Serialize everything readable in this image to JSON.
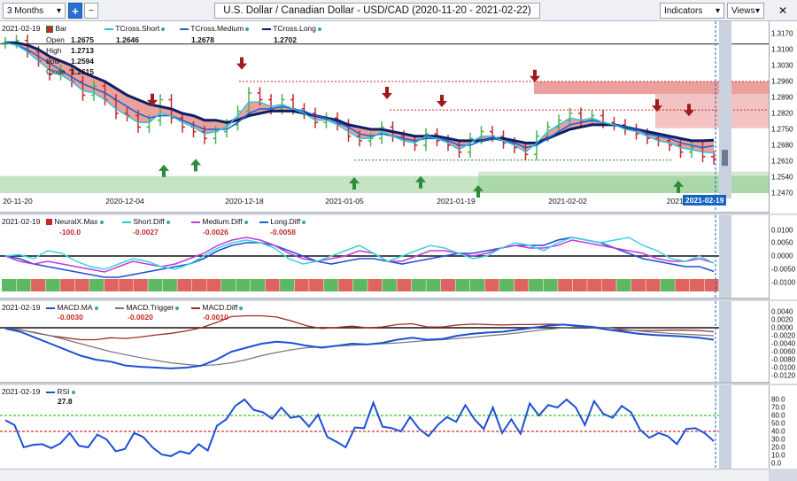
{
  "toolbar": {
    "period": "3 Months",
    "title": "U.S. Dollar / Canadian Dollar - USD/CAD (2020-11-20 - 2021-02-22)",
    "indicators": "Indicators",
    "views": "Views"
  },
  "price_pane": {
    "legend": {
      "date": "2021-02-19",
      "bar_label": "Bar",
      "open_label": "Open",
      "open": "1.2675",
      "high_label": "High",
      "high": "1.2713",
      "low_label": "Low",
      "low": "1.2594",
      "close_label": "Close",
      "close": "1.2615",
      "short_label": "TCross.Short",
      "short": "1.2646",
      "medium_label": "TCross.Medium",
      "medium": "1.2678",
      "long_label": "TCross.Long",
      "long": "1.2702"
    },
    "yticks": [
      "1.3170",
      "1.3100",
      "1.3030",
      "1.2960",
      "1.2890",
      "1.2820",
      "1.2750",
      "1.2680",
      "1.2610",
      "1.2540",
      "1.2470"
    ],
    "dates": [
      "20-11-20",
      "2020-12-04",
      "2020-12-18",
      "2021-01-05",
      "2021-01-19",
      "2021-02-02",
      "2021-0"
    ],
    "current_date": "2021-02-19"
  },
  "diff_pane": {
    "legend": {
      "date": "2021-02-19",
      "neural_label": "NeuralX.Max",
      "neural": "-100.0",
      "short_label": "Short.Diff",
      "short": "-0.0027",
      "medium_label": "Medium.Diff",
      "medium": "-0.0026",
      "long_label": "Long.Diff",
      "long": "-0.0058"
    },
    "yticks": [
      "0.0100",
      "0.0050",
      "0.0000",
      "-0.0050",
      "-0.0100"
    ]
  },
  "macd_pane": {
    "legend": {
      "date": "2021-02-19",
      "ma_label": "MACD.MA",
      "ma": "-0.0030",
      "trigger_label": "MACD.Trigger",
      "trigger": "-0.0020",
      "diff_label": "MACD.Diff",
      "diff": "-0.0010"
    },
    "yticks": [
      "0.0040",
      "0.0020",
      "0.0000",
      "-0.0020",
      "-0.0040",
      "-0.0060",
      "-0.0080",
      "-0.0100",
      "-0.0120"
    ]
  },
  "rsi_pane": {
    "legend": {
      "date": "2021-02-19",
      "rsi_label": "RSI",
      "rsi": "27.8"
    },
    "yticks": [
      "80.0",
      "70.0",
      "60.0",
      "50.0",
      "40.0",
      "30.0",
      "20.0",
      "10.0",
      "0.0"
    ]
  },
  "colors": {
    "bull": "#4caf50",
    "bear": "#c62828",
    "short": "#26c6da",
    "medium": "#1e63d6",
    "long": "#0b1f66",
    "cloud_red": "#d9534f",
    "cloud_green": "#7cc47a",
    "accent": "#1565c0"
  },
  "series": {
    "price_close": [
      1.313,
      1.314,
      1.309,
      1.305,
      1.299,
      1.301,
      1.296,
      1.29,
      1.294,
      1.288,
      1.282,
      1.281,
      1.276,
      1.279,
      1.288,
      1.28,
      1.276,
      1.274,
      1.271,
      1.274,
      1.277,
      1.283,
      1.291,
      1.288,
      1.284,
      1.288,
      1.284,
      1.282,
      1.278,
      1.28,
      1.277,
      1.272,
      1.27,
      1.271,
      1.276,
      1.272,
      1.27,
      1.268,
      1.273,
      1.27,
      1.268,
      1.265,
      1.271,
      1.274,
      1.272,
      1.269,
      1.267,
      1.264,
      1.272,
      1.276,
      1.279,
      1.282,
      1.279,
      1.281,
      1.278,
      1.277,
      1.275,
      1.273,
      1.271,
      1.27,
      1.268,
      1.265,
      1.267,
      1.263,
      1.262
    ],
    "tcross_short": [
      1.313,
      1.312,
      1.309,
      1.305,
      1.301,
      1.299,
      1.296,
      1.292,
      1.291,
      1.288,
      1.284,
      1.281,
      1.278,
      1.278,
      1.282,
      1.281,
      1.278,
      1.276,
      1.273,
      1.274,
      1.276,
      1.281,
      1.287,
      1.287,
      1.285,
      1.286,
      1.284,
      1.282,
      1.279,
      1.279,
      1.277,
      1.274,
      1.271,
      1.271,
      1.274,
      1.272,
      1.27,
      1.269,
      1.272,
      1.271,
      1.269,
      1.266,
      1.269,
      1.272,
      1.272,
      1.27,
      1.268,
      1.265,
      1.269,
      1.274,
      1.277,
      1.28,
      1.279,
      1.28,
      1.278,
      1.277,
      1.275,
      1.274,
      1.272,
      1.27,
      1.269,
      1.267,
      1.266,
      1.265,
      1.2646
    ],
    "tcross_medium": [
      1.313,
      1.312,
      1.31,
      1.307,
      1.304,
      1.301,
      1.298,
      1.295,
      1.293,
      1.291,
      1.288,
      1.285,
      1.282,
      1.28,
      1.281,
      1.281,
      1.279,
      1.277,
      1.275,
      1.275,
      1.275,
      1.278,
      1.282,
      1.284,
      1.284,
      1.285,
      1.284,
      1.283,
      1.281,
      1.28,
      1.278,
      1.276,
      1.273,
      1.272,
      1.273,
      1.272,
      1.271,
      1.27,
      1.271,
      1.271,
      1.27,
      1.268,
      1.268,
      1.27,
      1.271,
      1.27,
      1.269,
      1.267,
      1.268,
      1.271,
      1.274,
      1.277,
      1.278,
      1.279,
      1.278,
      1.277,
      1.276,
      1.275,
      1.273,
      1.272,
      1.271,
      1.269,
      1.268,
      1.267,
      1.2678
    ],
    "tcross_long": [
      1.313,
      1.313,
      1.312,
      1.31,
      1.307,
      1.305,
      1.303,
      1.3,
      1.298,
      1.296,
      1.293,
      1.29,
      1.288,
      1.286,
      1.285,
      1.284,
      1.282,
      1.281,
      1.279,
      1.279,
      1.278,
      1.279,
      1.281,
      1.282,
      1.283,
      1.283,
      1.283,
      1.282,
      1.281,
      1.28,
      1.279,
      1.277,
      1.276,
      1.275,
      1.275,
      1.274,
      1.273,
      1.272,
      1.272,
      1.272,
      1.271,
      1.27,
      1.27,
      1.27,
      1.271,
      1.271,
      1.27,
      1.269,
      1.269,
      1.271,
      1.273,
      1.275,
      1.276,
      1.277,
      1.277,
      1.277,
      1.276,
      1.275,
      1.274,
      1.273,
      1.272,
      1.271,
      1.27,
      1.27,
      1.2702
    ],
    "short_diff": [
      0.0,
      0.0005,
      -0.001,
      0.002,
      0.001,
      -0.002,
      -0.004,
      -0.005,
      -0.003,
      -0.001,
      -0.002,
      -0.004,
      -0.005,
      -0.003,
      0.0,
      0.003,
      0.005,
      0.006,
      0.005,
      0.003,
      -0.001,
      -0.003,
      -0.002,
      0.0,
      0.002,
      0.004,
      0.001,
      -0.002,
      0.0,
      0.002,
      0.004,
      0.003,
      0.001,
      -0.001,
      0.0,
      0.003,
      0.005,
      0.004,
      0.002,
      0.005,
      0.007,
      0.006,
      0.005,
      0.006,
      0.007,
      0.004,
      0.002,
      -0.001,
      -0.002,
      0.0,
      -0.0027
    ],
    "medium_diff": [
      0.0,
      -0.002,
      -0.003,
      -0.002,
      -0.003,
      -0.004,
      -0.005,
      -0.006,
      -0.004,
      -0.002,
      -0.003,
      -0.004,
      -0.003,
      -0.001,
      0.001,
      0.004,
      0.006,
      0.007,
      0.006,
      0.004,
      0.001,
      -0.001,
      -0.002,
      -0.001,
      0.0,
      0.002,
      0.001,
      -0.002,
      -0.002,
      0.0,
      0.002,
      0.002,
      0.001,
      0.0,
      0.001,
      0.003,
      0.004,
      0.003,
      0.003,
      0.004,
      0.006,
      0.005,
      0.004,
      0.003,
      0.002,
      0.001,
      -0.001,
      -0.002,
      -0.002,
      -0.001,
      -0.0026
    ],
    "long_diff": [
      0.0,
      -0.001,
      -0.003,
      -0.004,
      -0.005,
      -0.006,
      -0.007,
      -0.008,
      -0.008,
      -0.007,
      -0.006,
      -0.005,
      -0.004,
      -0.003,
      -0.001,
      0.002,
      0.004,
      0.005,
      0.005,
      0.004,
      0.002,
      0.0,
      -0.002,
      -0.003,
      -0.002,
      -0.001,
      -0.001,
      -0.002,
      -0.003,
      -0.002,
      -0.001,
      0.0,
      0.001,
      0.001,
      0.002,
      0.003,
      0.004,
      0.004,
      0.004,
      0.006,
      0.007,
      0.006,
      0.005,
      0.003,
      0.001,
      -0.001,
      -0.002,
      -0.003,
      -0.004,
      -0.004,
      -0.0058
    ],
    "neural_blocks": [
      1,
      1,
      0,
      1,
      0,
      0,
      1,
      0,
      0,
      0,
      1,
      1,
      0,
      0,
      0,
      1,
      1,
      1,
      0,
      1,
      0,
      0,
      1,
      0,
      1,
      0,
      1,
      0,
      1,
      1,
      0,
      1,
      1,
      0,
      1,
      0,
      1,
      1,
      0,
      0,
      0,
      0,
      1,
      0,
      0,
      1,
      0,
      0,
      0
    ],
    "macd_ma": [
      -0.0002,
      -0.001,
      -0.0025,
      -0.004,
      -0.0055,
      -0.007,
      -0.008,
      -0.0085,
      -0.0095,
      -0.0098,
      -0.01,
      -0.0102,
      -0.01,
      -0.0095,
      -0.008,
      -0.006,
      -0.005,
      -0.004,
      -0.0035,
      -0.0038,
      -0.0045,
      -0.005,
      -0.0045,
      -0.004,
      -0.0042,
      -0.0038,
      -0.003,
      -0.0025,
      -0.003,
      -0.0028,
      -0.002,
      -0.0015,
      -0.0012,
      -0.001,
      -0.0005,
      0.0,
      0.0005,
      0.0008,
      0.0005,
      0.0002,
      -0.0005,
      -0.001,
      -0.0015,
      -0.0018,
      -0.002,
      -0.0022,
      -0.0025,
      -0.003
    ],
    "macd_trigger": [
      -0.0001,
      -0.0005,
      -0.0012,
      -0.002,
      -0.003,
      -0.004,
      -0.005,
      -0.006,
      -0.0068,
      -0.0075,
      -0.0082,
      -0.0088,
      -0.0092,
      -0.0095,
      -0.0093,
      -0.0088,
      -0.008,
      -0.007,
      -0.0062,
      -0.0055,
      -0.005,
      -0.0048,
      -0.0046,
      -0.0044,
      -0.0042,
      -0.004,
      -0.0038,
      -0.0035,
      -0.0032,
      -0.003,
      -0.0027,
      -0.0024,
      -0.002,
      -0.0017,
      -0.0013,
      -0.0008,
      -0.0004,
      0.0,
      0.0002,
      0.0002,
      0.0,
      -0.0004,
      -0.0008,
      -0.0011,
      -0.0014,
      -0.0016,
      -0.0018,
      -0.002
    ],
    "macd_diff": [
      -0.0001,
      -0.0005,
      -0.0013,
      -0.002,
      -0.0025,
      -0.003,
      -0.003,
      -0.0025,
      -0.0027,
      -0.0023,
      -0.0018,
      -0.0014,
      -0.0008,
      0.0,
      0.0013,
      0.0028,
      0.003,
      0.003,
      0.0027,
      0.0017,
      0.0005,
      -0.0002,
      0.0001,
      0.0004,
      0.0,
      0.0002,
      0.0008,
      0.001,
      0.0002,
      0.0002,
      0.0007,
      0.0009,
      0.0008,
      0.0007,
      0.0008,
      0.0008,
      0.0009,
      0.0008,
      0.0003,
      0.0,
      -0.0005,
      -0.0006,
      -0.0007,
      -0.0007,
      -0.0006,
      -0.0006,
      -0.0007,
      -0.001
    ],
    "rsi": [
      54,
      48,
      20,
      23,
      24,
      19,
      25,
      38,
      22,
      20,
      36,
      30,
      15,
      18,
      38,
      33,
      20,
      11,
      9,
      15,
      12,
      24,
      16,
      47,
      55,
      72,
      80,
      67,
      64,
      56,
      70,
      57,
      59,
      46,
      61,
      33,
      27,
      20,
      45,
      44,
      76,
      46,
      44,
      40,
      58,
      43,
      34,
      48,
      58,
      52,
      73,
      55,
      43,
      70,
      38,
      55,
      37,
      75,
      60,
      73,
      70,
      80,
      70,
      48,
      78,
      62,
      57,
      72,
      64,
      42,
      32,
      38,
      34,
      24,
      43,
      44,
      38,
      27.8
    ]
  }
}
